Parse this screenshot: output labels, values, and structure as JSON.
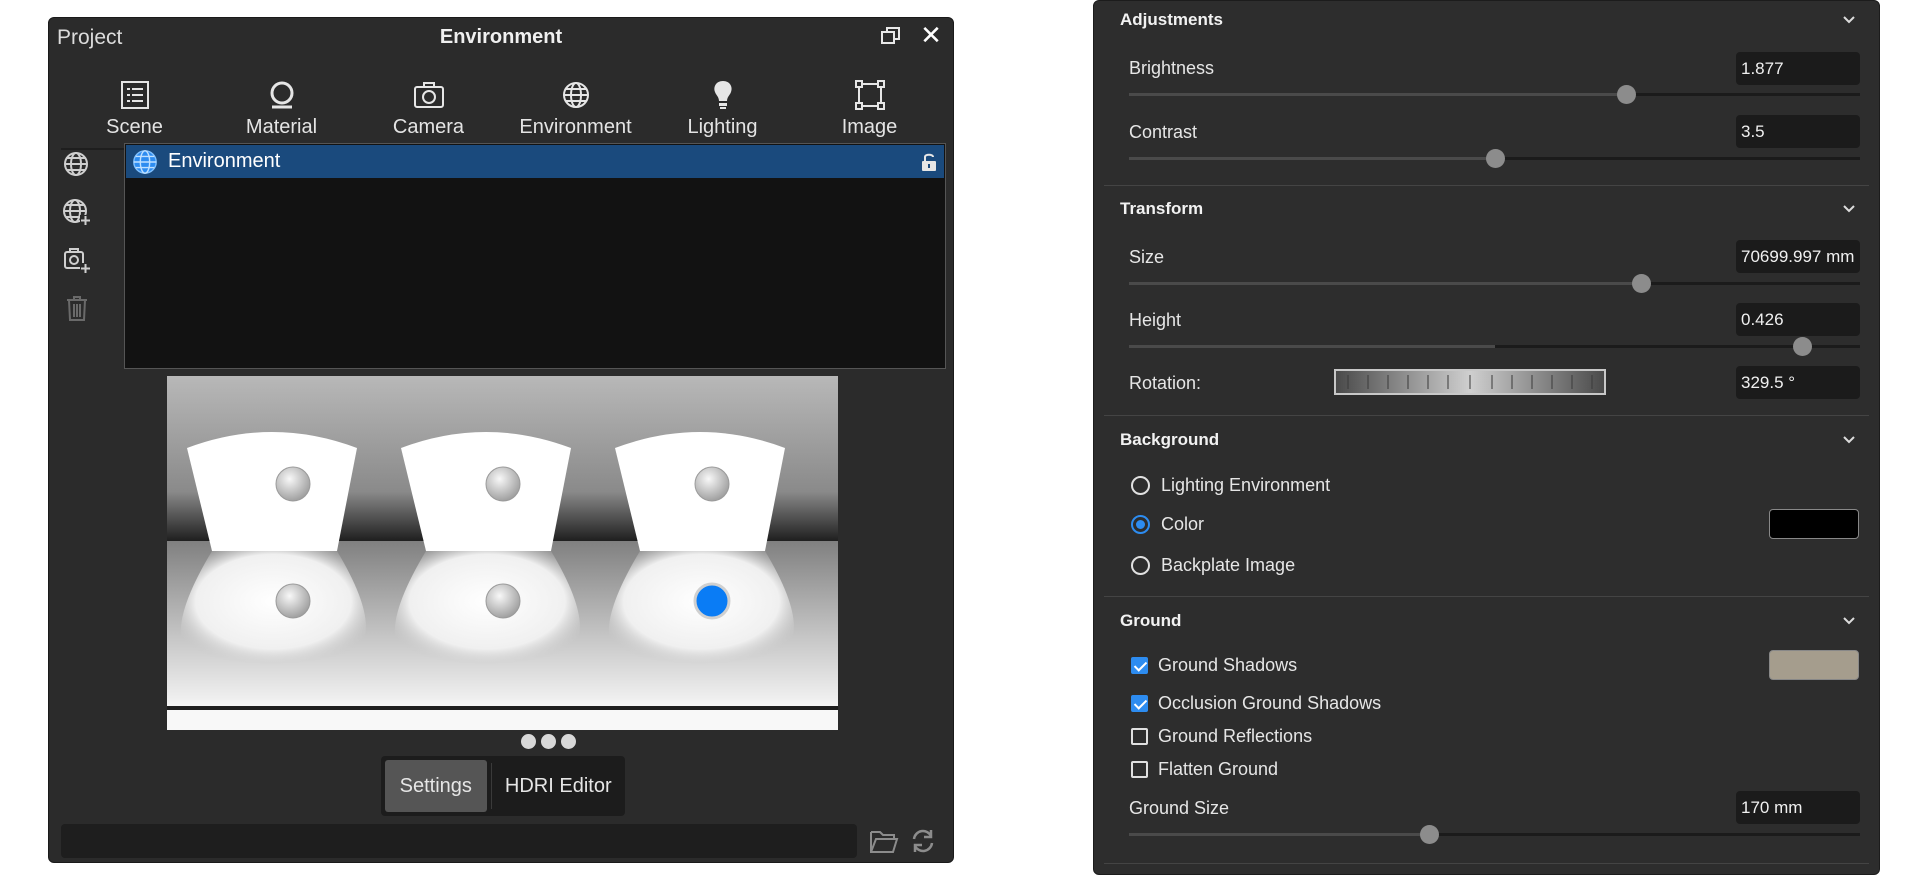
{
  "left": {
    "title_project": "Project",
    "title": "Environment",
    "tabs": [
      {
        "label": "Scene",
        "icon": "list-icon",
        "active": false
      },
      {
        "label": "Material",
        "icon": "material-ball-icon",
        "active": false
      },
      {
        "label": "Camera",
        "icon": "camera-icon",
        "active": false
      },
      {
        "label": "Environment",
        "icon": "globe-icon",
        "active": true
      },
      {
        "label": "Lighting",
        "icon": "bulb-icon",
        "active": false
      },
      {
        "label": "Image",
        "icon": "frame-icon",
        "active": false
      }
    ],
    "environment_item": "Environment",
    "bottom_tabs": {
      "settings": "Settings",
      "hdri_editor": "HDRI Editor"
    },
    "path_value": ""
  },
  "right": {
    "adjustments": {
      "title": "Adjustments",
      "brightness_label": "Brightness",
      "brightness_value": "1.877",
      "brightness_fraction": 0.68,
      "contrast_label": "Contrast",
      "contrast_value": "3.5",
      "contrast_fraction": 0.5
    },
    "transform": {
      "title": "Transform",
      "size_label": "Size",
      "size_value": "70699.997 mm",
      "size_fraction": 0.7,
      "height_label": "Height",
      "height_value": "0.426",
      "height_fraction": 0.92,
      "rotation_label": "Rotation:",
      "rotation_value": "329.5 °"
    },
    "background": {
      "title": "Background",
      "options": [
        "Lighting Environment",
        "Color",
        "Backplate Image"
      ],
      "selected": "Color",
      "color": "#000000"
    },
    "ground": {
      "title": "Ground",
      "shadows_label": "Ground Shadows",
      "shadows_checked": true,
      "shadow_color": "#a59d8d",
      "occlusion_label": "Occlusion Ground Shadows",
      "occlusion_checked": true,
      "reflections_label": "Ground Reflections",
      "reflections_checked": false,
      "flatten_label": "Flatten Ground",
      "flatten_checked": false,
      "size_label": "Ground Size",
      "size_value": "170 mm",
      "size_fraction": 0.41
    }
  },
  "colors": {
    "accent": "#2d8cf0",
    "selection": "#1a4a7d",
    "panel": "#2b2b2b"
  }
}
